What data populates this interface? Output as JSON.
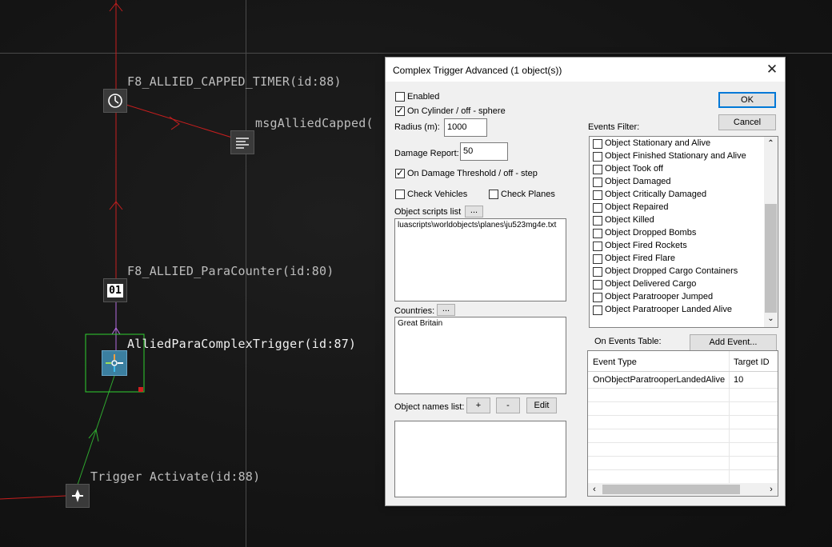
{
  "canvas": {
    "nodes": [
      {
        "label": "F8_ALLIED_CAPPED_TIMER(id:88)",
        "icon": "clock-icon"
      },
      {
        "label": "msgAlliedCapped(",
        "icon": "message-icon"
      },
      {
        "label": "F8_ALLIED_ParaCounter(id:80)",
        "icon": "counter-icon",
        "counter_text": "01"
      },
      {
        "label": "AlliedParaComplexTrigger(id:87)",
        "icon": "complex-trigger-icon"
      },
      {
        "label": "Trigger Activate(id:88)",
        "icon": "trigger-activate-icon"
      }
    ],
    "colors": {
      "link_red": "#c81e1e",
      "link_green": "#2fa82f",
      "link_purple": "#b36be0",
      "selection": "#2fd02f"
    }
  },
  "dialog": {
    "title": "Complex Trigger Advanced (1 object(s))",
    "close_label": "✕",
    "ok_label": "OK",
    "cancel_label": "Cancel",
    "enabled": {
      "label": "Enabled",
      "checked": false
    },
    "on_cylinder": {
      "label": "On Cylinder / off - sphere",
      "checked": true
    },
    "radius": {
      "label": "Radius (m):",
      "value": "1000"
    },
    "damage_report": {
      "label": "Damage Report:",
      "value": "50"
    },
    "damage_threshold": {
      "label": "On Damage Threshold / off - step",
      "checked": true
    },
    "check_vehicles": {
      "label": "Check Vehicles",
      "checked": false
    },
    "check_planes": {
      "label": "Check Planes",
      "checked": false
    },
    "scripts": {
      "label": "Object scripts list",
      "browse": "...",
      "value": "luascripts\\worldobjects\\planes\\ju523mg4e.txt"
    },
    "countries": {
      "label": "Countries:",
      "browse": "...",
      "items": [
        "Great Britain"
      ]
    },
    "names": {
      "label": "Object names list:",
      "add": "+",
      "remove": "-",
      "edit": "Edit"
    },
    "events_filter": {
      "label": "Events Filter:",
      "items": [
        "Object Stationary and Alive",
        "Object Finished Stationary and Alive",
        "Object Took off",
        "Object Damaged",
        "Object Critically Damaged",
        "Object Repaired",
        "Object Killed",
        "Object Dropped Bombs",
        "Object Fired Rockets",
        "Object Fired Flare",
        "Object Dropped Cargo Containers",
        "Object Delivered Cargo",
        "Object Paratrooper Jumped",
        "Object Paratrooper Landed Alive"
      ]
    },
    "events_table": {
      "label": "On Events Table:",
      "add_event": "Add Event...",
      "columns": [
        "Event Type",
        "Target ID"
      ],
      "rows": [
        [
          "OnObjectParatrooperLandedAlive",
          "10"
        ]
      ]
    }
  }
}
